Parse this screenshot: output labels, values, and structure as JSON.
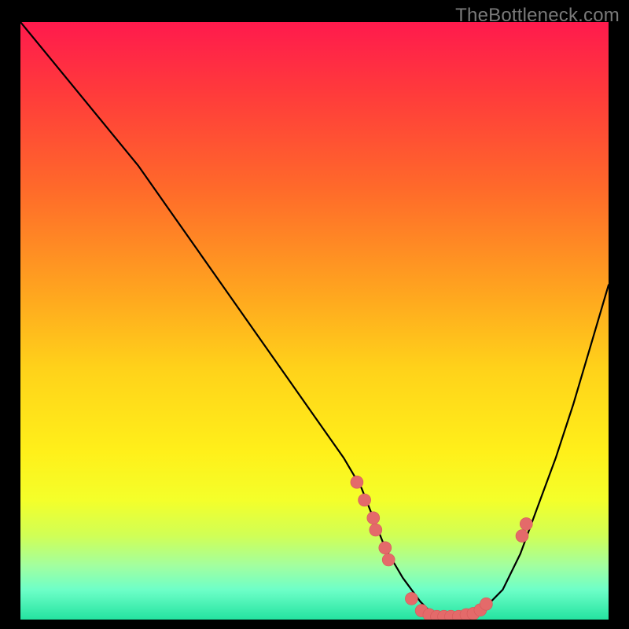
{
  "watermark": "TheBottleneck.com",
  "colors": {
    "background": "#000000",
    "curve": "#000000",
    "dot_fill": "#e46a6a",
    "dot_stroke": "#d45a5a",
    "gradient_stops": [
      "#ff1a4d",
      "#ff3b3b",
      "#ff6a2a",
      "#ffa41f",
      "#ffd21a",
      "#fff01a",
      "#f4ff2a",
      "#d0ff56",
      "#a2ffa0",
      "#6effc8",
      "#24e3a0"
    ]
  },
  "chart_data": {
    "type": "line",
    "title": "",
    "xlabel": "",
    "ylabel": "",
    "xlim": [
      0,
      100
    ],
    "ylim": [
      0,
      100
    ],
    "annotations": [
      "TheBottleneck.com"
    ],
    "series": [
      {
        "name": "curve",
        "x": [
          0,
          5,
          10,
          15,
          20,
          25,
          30,
          35,
          40,
          45,
          50,
          55,
          58,
          60,
          62,
          65,
          68,
          70,
          72,
          75,
          78,
          82,
          85,
          88,
          91,
          94,
          97,
          100
        ],
        "y": [
          100,
          94,
          88,
          82,
          76,
          69,
          62,
          55,
          48,
          41,
          34,
          27,
          22,
          17,
          12,
          7,
          3,
          1,
          0,
          0,
          1,
          5,
          11,
          19,
          27,
          36,
          46,
          56
        ]
      }
    ],
    "scatter": [
      {
        "name": "dots",
        "x": [
          57.2,
          58.5,
          60.0,
          60.4,
          62.0,
          62.6,
          66.5,
          68.2,
          69.5,
          70.8,
          72.0,
          73.2,
          74.5,
          75.8,
          77.0,
          78.2,
          79.2,
          85.3,
          86.0
        ],
        "y": [
          23.0,
          20.0,
          17.0,
          15.0,
          12.0,
          10.0,
          3.5,
          1.5,
          0.8,
          0.5,
          0.5,
          0.5,
          0.5,
          0.8,
          1.0,
          1.6,
          2.6,
          14.0,
          16.0
        ]
      }
    ]
  }
}
